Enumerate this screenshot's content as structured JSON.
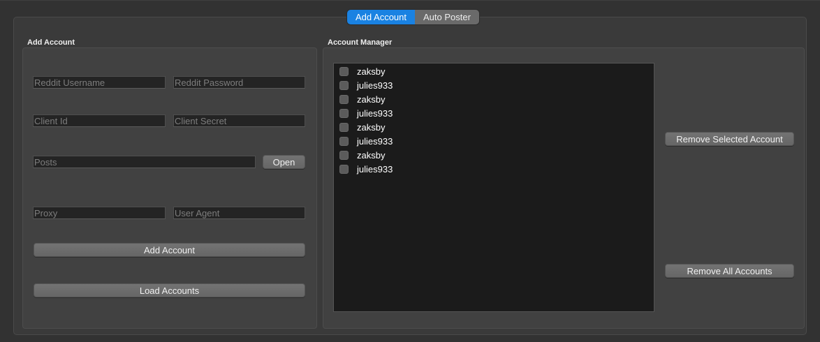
{
  "tabs": [
    {
      "label": "Add Account",
      "active": true
    },
    {
      "label": "Auto Poster",
      "active": false
    }
  ],
  "add_account": {
    "title": "Add Account",
    "fields": {
      "username_placeholder": "Reddit Username",
      "password_placeholder": "Reddit Password",
      "client_id_placeholder": "Client Id",
      "client_secret_placeholder": "Client Secret",
      "posts_placeholder": "Posts",
      "proxy_placeholder": "Proxy",
      "user_agent_placeholder": "User Agent"
    },
    "open_label": "Open",
    "add_button_label": "Add Account",
    "load_button_label": "Load Accounts"
  },
  "account_manager": {
    "title": "Account Manager",
    "accounts": [
      {
        "name": "zaksby",
        "checked": false
      },
      {
        "name": "julies933",
        "checked": false
      },
      {
        "name": "zaksby",
        "checked": false
      },
      {
        "name": "julies933",
        "checked": false
      },
      {
        "name": "zaksby",
        "checked": false
      },
      {
        "name": "julies933",
        "checked": false
      },
      {
        "name": "zaksby",
        "checked": false
      },
      {
        "name": "julies933",
        "checked": false
      }
    ],
    "remove_selected_label": "Remove Selected Account",
    "remove_all_label": "Remove All Accounts"
  },
  "colors": {
    "accent": "#1a82e2",
    "window_bg": "#323232",
    "panel_bg": "#414141",
    "list_bg": "#1b1b1b"
  }
}
